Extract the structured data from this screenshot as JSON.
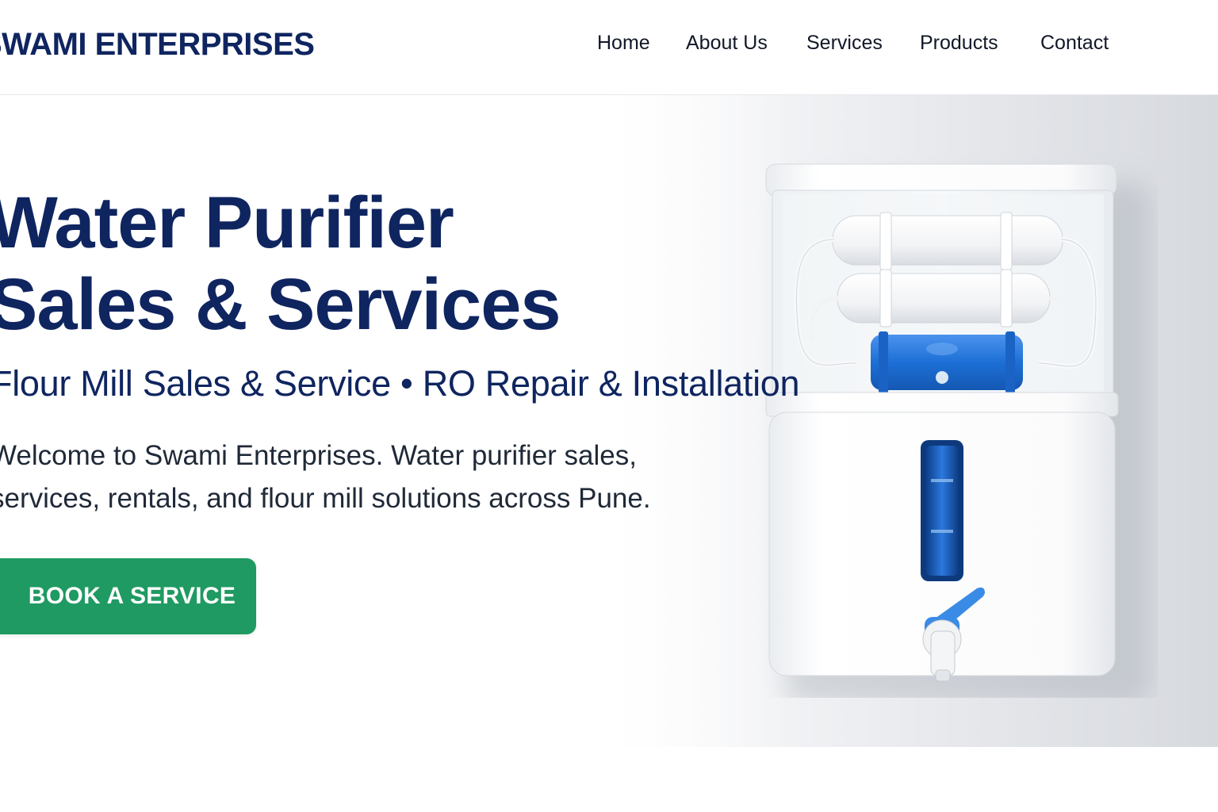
{
  "header": {
    "brand": "SWAMI ENTERPRISES",
    "nav": [
      {
        "label": "Home"
      },
      {
        "label": "About Us"
      },
      {
        "label": "Services"
      },
      {
        "label": "Products"
      },
      {
        "label": "Contact"
      }
    ]
  },
  "hero": {
    "title_line1": "Water Purifier",
    "title_line2": "Sales & Services",
    "subtitle": "Flour Mill Sales & Service • RO Repair & Installation",
    "description": "Welcome to Swami Enterprises. Water purifier sales, services, rentals, and flour mill solutions across Pune.",
    "cta_label": "BOOK A SERVICE",
    "product_image_icon": "water-purifier-illustration"
  },
  "colors": {
    "brand_navy": "#0f2560",
    "cta_green": "#1f9a62",
    "accent_blue": "#1d6fd6"
  }
}
